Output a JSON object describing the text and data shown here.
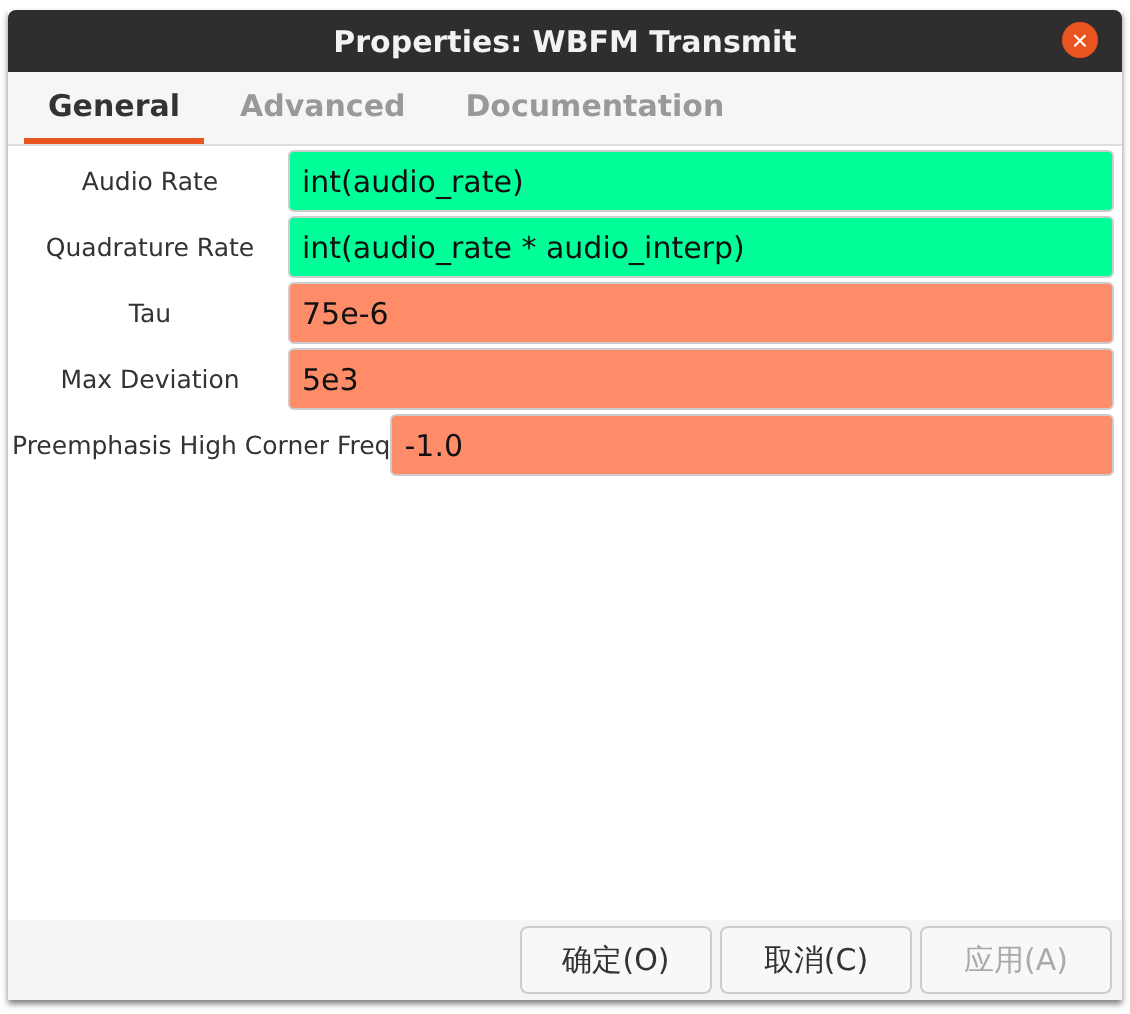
{
  "window": {
    "title": "Properties: WBFM Transmit",
    "close": "×"
  },
  "tabs": [
    {
      "label": "General",
      "selected": true
    },
    {
      "label": "Advanced",
      "selected": false
    },
    {
      "label": "Documentation",
      "selected": false
    }
  ],
  "params": [
    {
      "label": "Audio Rate",
      "value": "int(audio_rate)",
      "color": "#00ff99"
    },
    {
      "label": "Quadrature Rate",
      "value": "int(audio_rate * audio_interp)",
      "color": "#00ff99"
    },
    {
      "label": "Tau",
      "value": "75e-6",
      "color": "#ff8c69"
    },
    {
      "label": "Max Deviation",
      "value": "5e3",
      "color": "#ff8c69"
    },
    {
      "label": "Preemphasis High Corner Freq",
      "value": "-1.0",
      "color": "#ff8c69"
    }
  ],
  "buttons": [
    {
      "label": "确定(O)",
      "disabled": false
    },
    {
      "label": "取消(C)",
      "disabled": false
    },
    {
      "label": "应用(A)",
      "disabled": true
    }
  ]
}
